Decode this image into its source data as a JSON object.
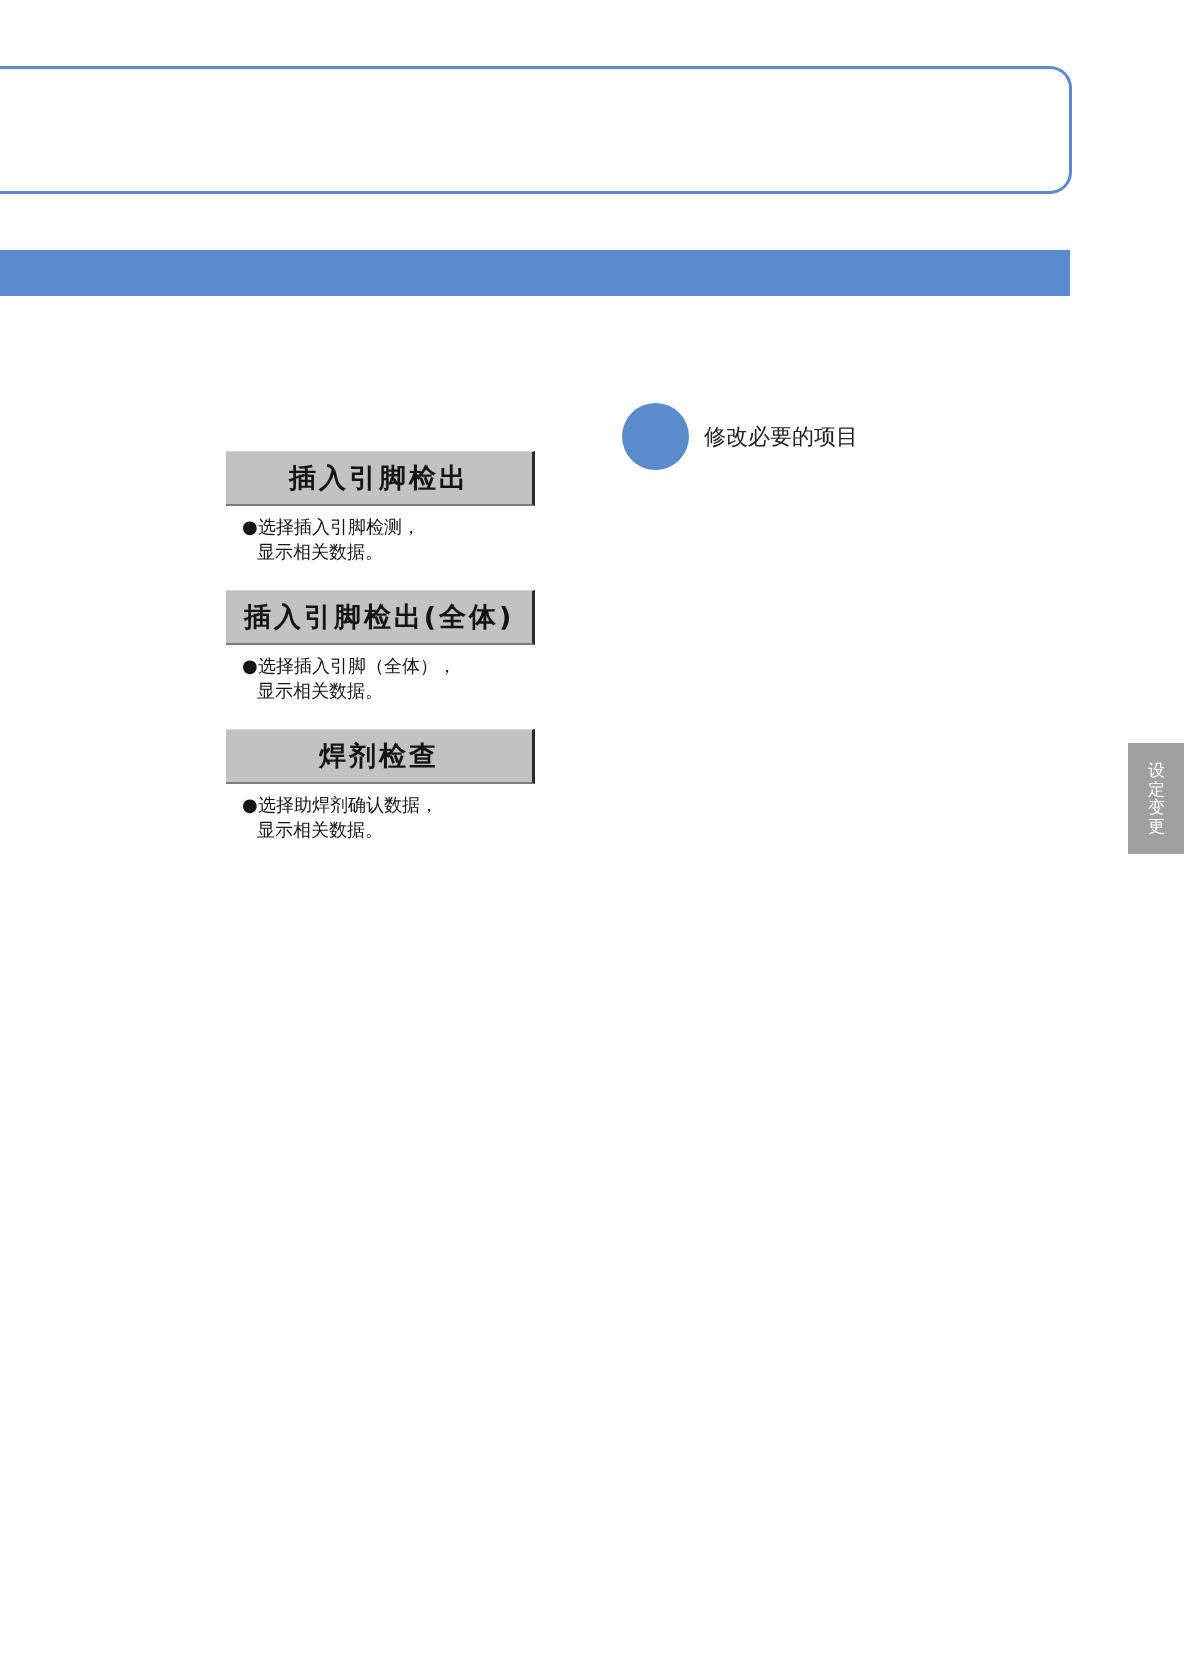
{
  "step": {
    "label": "修改必要的项目"
  },
  "buttons": [
    {
      "label": "插入引脚检出",
      "description": [
        "●选择插入引脚检测，",
        "显示相关数据。"
      ]
    },
    {
      "label": "插入引脚检出(全体)",
      "description": [
        "●选择插入引脚（全体），",
        "显示相关数据。"
      ]
    },
    {
      "label": "焊剂检查",
      "description": [
        "●选择助焊剂确认数据，",
        "显示相关数据。"
      ]
    }
  ],
  "side_tab": {
    "label": "设定变更"
  }
}
